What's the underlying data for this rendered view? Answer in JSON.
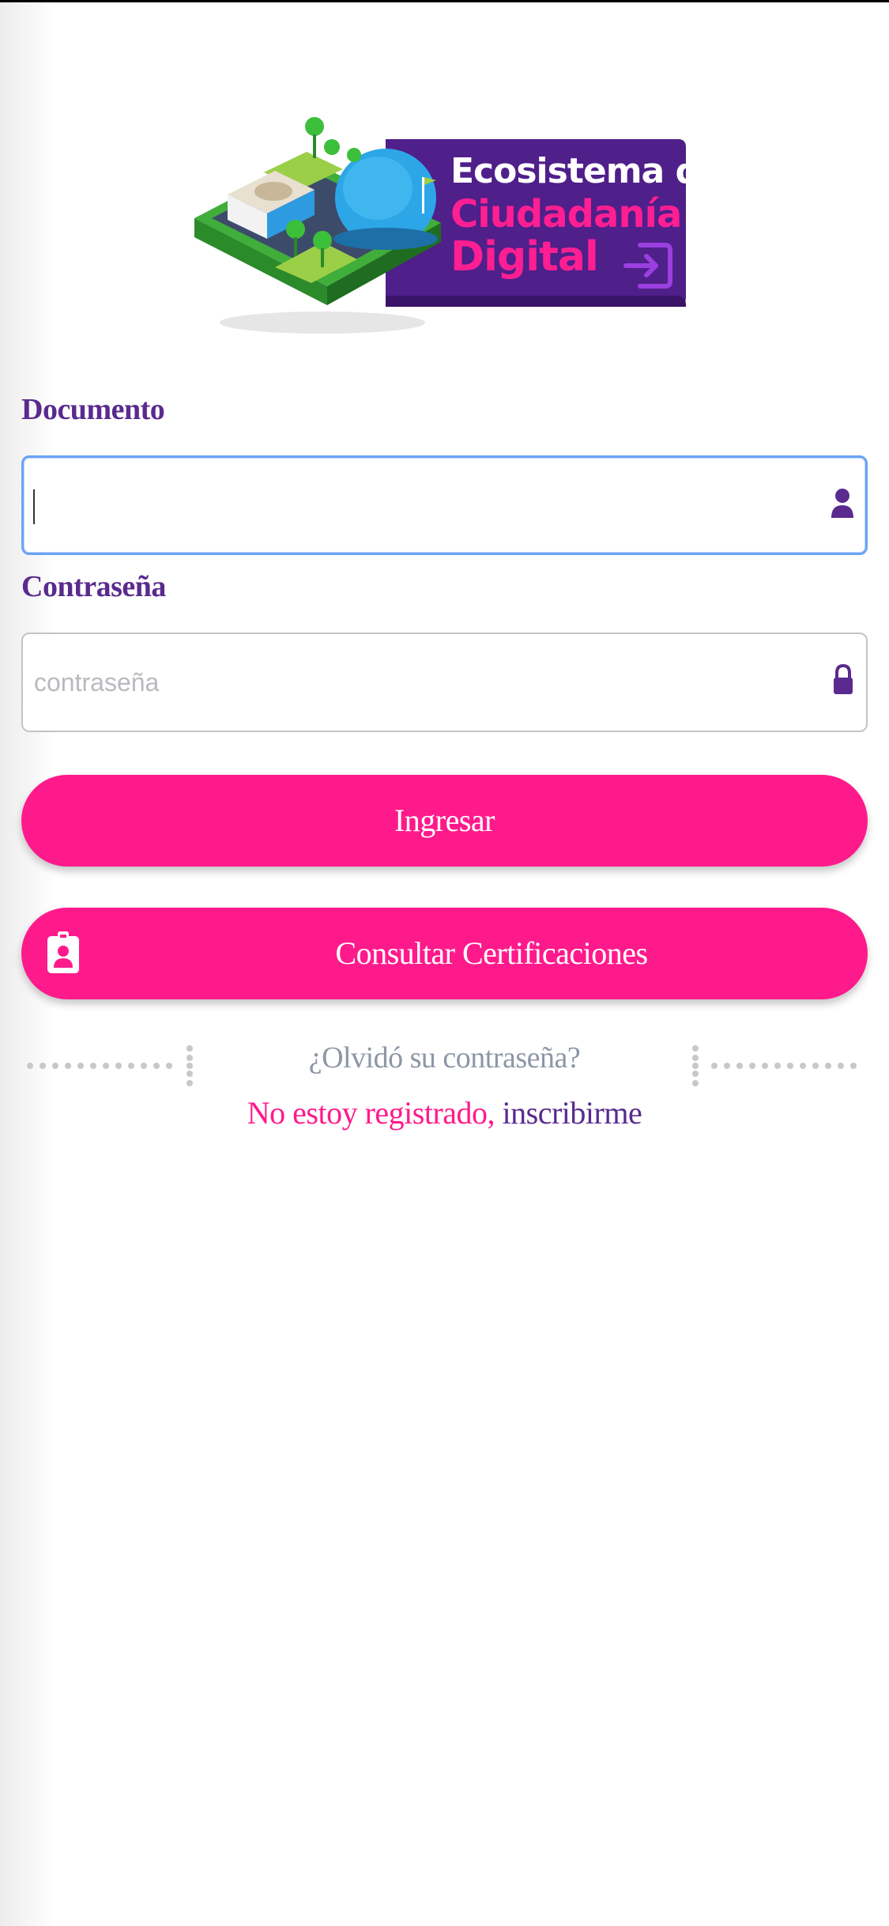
{
  "logo": {
    "line1": "Ecosistema de",
    "line2": "Ciudadanía",
    "line3": "Digital"
  },
  "form": {
    "document_label": "Documento",
    "document_value": "",
    "document_placeholder": "",
    "password_label": "Contraseña",
    "password_value": "",
    "password_placeholder": "contraseña"
  },
  "buttons": {
    "login": "Ingresar",
    "certifications": "Consultar Certificaciones"
  },
  "links": {
    "forgot_password": "¿Olvidó su contraseña?",
    "not_registered": "No estoy registrado,",
    "register": "inscribirme"
  },
  "icons": {
    "document_field": "user-icon",
    "password_field": "lock-icon",
    "certifications": "id-badge-icon",
    "logo_exit": "sign-in-icon"
  },
  "colors": {
    "brand_purple": "#5a2a8e",
    "brand_pink": "#ff1a8c",
    "focus_blue": "#6aa3f5"
  }
}
